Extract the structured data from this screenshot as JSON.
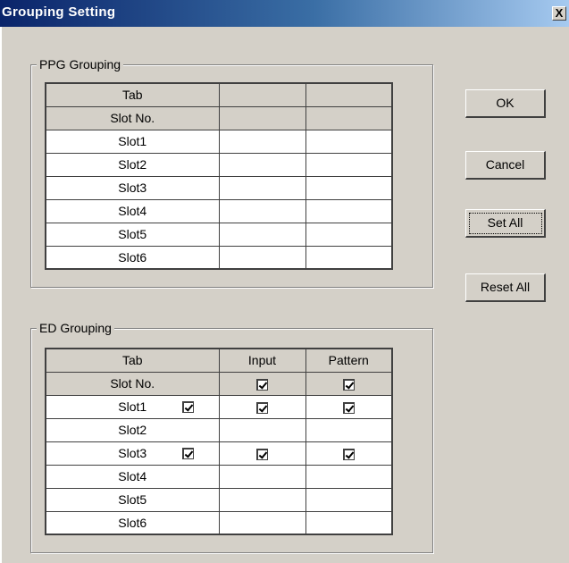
{
  "window": {
    "title": "Grouping Setting",
    "close_label": "X"
  },
  "ppg": {
    "legend": "PPG Grouping",
    "tab_label": "Tab",
    "slotno_label": "Slot No.",
    "slots": [
      "Slot1",
      "Slot2",
      "Slot3",
      "Slot4",
      "Slot5",
      "Slot6"
    ]
  },
  "ed": {
    "legend": "ED Grouping",
    "tab_label": "Tab",
    "slotno_label": "Slot No.",
    "col_input": "Input",
    "col_pattern": "Pattern",
    "header_input_checked": true,
    "header_pattern_checked": true,
    "rows": [
      {
        "label": "Slot1",
        "slot_checked": true,
        "input_checked": true,
        "pattern_checked": true
      },
      {
        "label": "Slot2",
        "slot_checked": false,
        "input_checked": false,
        "pattern_checked": false
      },
      {
        "label": "Slot3",
        "slot_checked": true,
        "input_checked": true,
        "pattern_checked": true
      },
      {
        "label": "Slot4",
        "slot_checked": false,
        "input_checked": false,
        "pattern_checked": false
      },
      {
        "label": "Slot5",
        "slot_checked": false,
        "input_checked": false,
        "pattern_checked": false
      },
      {
        "label": "Slot6",
        "slot_checked": false,
        "input_checked": false,
        "pattern_checked": false
      }
    ]
  },
  "buttons": {
    "ok": "OK",
    "cancel": "Cancel",
    "set_all": "Set All",
    "reset_all": "Reset All"
  }
}
